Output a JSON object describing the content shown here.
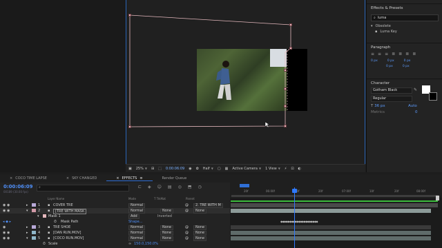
{
  "viewer": {
    "zoom": "25%",
    "timecode": "0:00:06:09",
    "resolution": "Half",
    "camera": "Active Camera",
    "view": "1 View"
  },
  "right_panel": {
    "effects_title": "Effects & Presets",
    "search_value": "luma",
    "tree_group": "Obsolete",
    "tree_item": "Luma Key",
    "paragraph_title": "Paragraph",
    "indent_values": [
      "0 px",
      "0 px",
      "0 px",
      "0 px",
      "0 px"
    ],
    "character_title": "Character",
    "font_name": "Gotham Black",
    "font_style": "Regular",
    "font_size": "36 px",
    "leading": "Auto",
    "kerning": "Metrics",
    "tracking": "0"
  },
  "tabs": [
    {
      "label": "COCO TIME LAPSE",
      "active": false
    },
    {
      "label": "SKY CHANGED",
      "active": false
    },
    {
      "label": "EFFECTS",
      "active": true
    },
    {
      "label": "Render Queue",
      "active": false
    }
  ],
  "timeline": {
    "timecode": "0:00:06:09",
    "fps_label": "00189 (30.00 fps)",
    "columns": {
      "name": "Layer Name",
      "mode": "Mode",
      "trk": "T TrkMat",
      "parent": "Parent"
    },
    "ruler_ticks": [
      "20f",
      "06:00f",
      "10f",
      "20f",
      "07:00f",
      "10f",
      "20f",
      "08:00f"
    ],
    "layers": [
      {
        "num": "1",
        "name": "COVER TRE",
        "mode": "Normal",
        "trk": "",
        "parent": "2. TRE WITH M"
      },
      {
        "num": "2",
        "name": "[TRE WITH MASK",
        "mode": "Normal",
        "trk": "None",
        "parent": "None"
      },
      {
        "num": "",
        "name": "Mask 1",
        "mode": "Add",
        "trk": "Inverted",
        "parent": ""
      },
      {
        "num": "",
        "name": "Mask Path",
        "mode": "Shape...",
        "trk": "",
        "parent": ""
      },
      {
        "num": "3",
        "name": "TRE SHOE",
        "mode": "Normal",
        "trk": "None",
        "parent": "None"
      },
      {
        "num": "4",
        "name": "[DAN RUN.MOV]",
        "mode": "Normal",
        "trk": "None",
        "parent": "None"
      },
      {
        "num": "5",
        "name": "[COCO RUN.MOV]",
        "mode": "Normal",
        "trk": "None",
        "parent": "None"
      },
      {
        "num": "",
        "name": "Scale",
        "mode": "150.0,150.0%",
        "trk": "",
        "parent": ""
      }
    ]
  },
  "colors": {
    "accent": "#2f79ff",
    "mask": "#e4b8bd",
    "timecode": "#4f8ff8"
  }
}
